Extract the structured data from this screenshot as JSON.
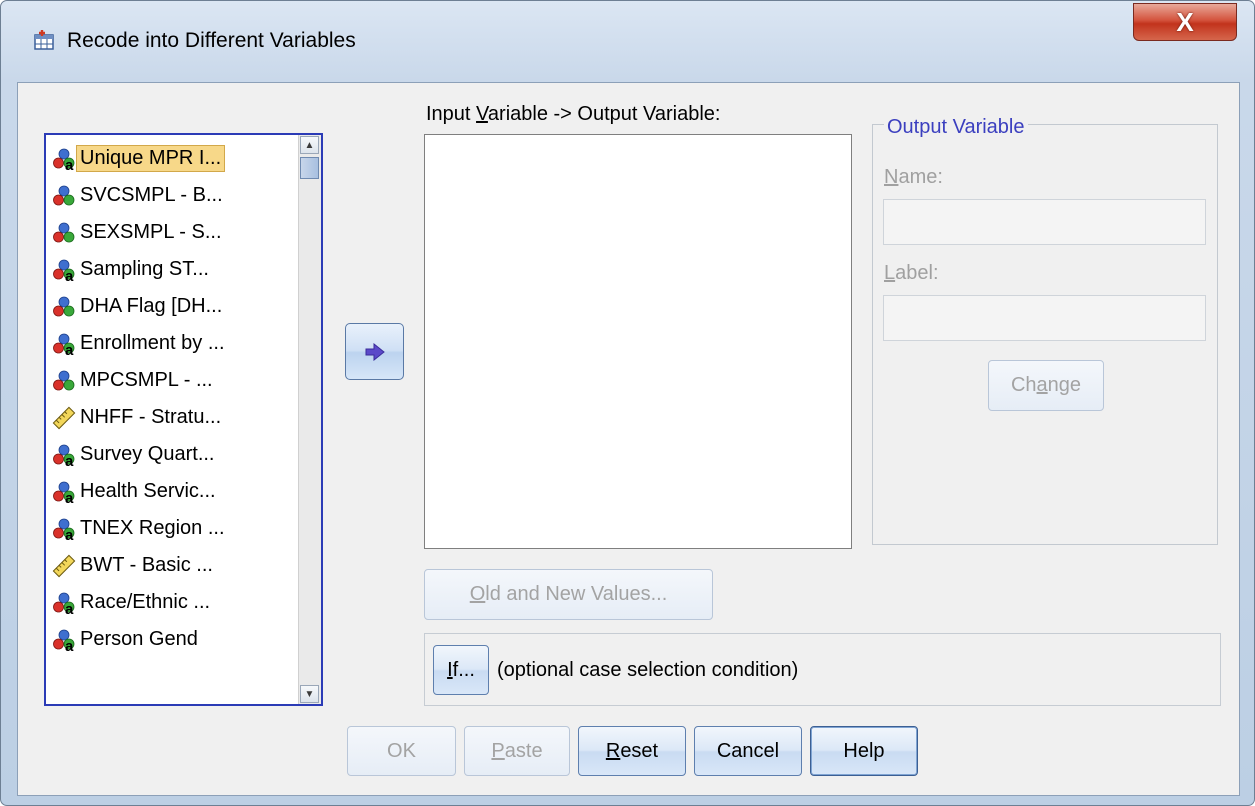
{
  "window": {
    "title": "Recode into Different Variables",
    "close_label": "X"
  },
  "variables": [
    {
      "label": "Unique MPR I...",
      "type": "nominal-string",
      "selected": true
    },
    {
      "label": "SVCSMPL - B...",
      "type": "nominal",
      "selected": false
    },
    {
      "label": "SEXSMPL - S...",
      "type": "nominal",
      "selected": false
    },
    {
      "label": "Sampling ST...",
      "type": "nominal-string",
      "selected": false
    },
    {
      "label": "DHA Flag [DH...",
      "type": "nominal",
      "selected": false
    },
    {
      "label": "Enrollment by ...",
      "type": "nominal-string",
      "selected": false
    },
    {
      "label": "MPCSMPL - ...",
      "type": "nominal",
      "selected": false
    },
    {
      "label": "NHFF - Stratu...",
      "type": "scale",
      "selected": false
    },
    {
      "label": "Survey Quart...",
      "type": "nominal-string",
      "selected": false
    },
    {
      "label": "Health Servic...",
      "type": "nominal-string",
      "selected": false
    },
    {
      "label": "TNEX Region ...",
      "type": "nominal-string",
      "selected": false
    },
    {
      "label": "BWT - Basic ...",
      "type": "scale",
      "selected": false
    },
    {
      "label": "Race/Ethnic ...",
      "type": "nominal-string",
      "selected": false
    },
    {
      "label": "Person Gend",
      "type": "nominal-string",
      "selected": false
    }
  ],
  "io": {
    "label_pre": "Input ",
    "label_u": "V",
    "label_post": "ariable -> Output Variable:"
  },
  "output_variable": {
    "title": "Output Variable",
    "name_label_u": "N",
    "name_label_rest": "ame:",
    "label_label_u": "L",
    "label_label_rest": "abel:",
    "change_pre": "Ch",
    "change_u": "a",
    "change_post": "nge"
  },
  "old_new": {
    "u": "O",
    "rest": "ld and New Values..."
  },
  "if_panel": {
    "button_u": "I",
    "button_rest": "f...",
    "text": "(optional case selection condition)"
  },
  "footer": {
    "ok": "OK",
    "paste_u": "P",
    "paste_rest": "aste",
    "reset_u": "R",
    "reset_rest": "eset",
    "cancel": "Cancel",
    "help": "Help"
  },
  "colors": {
    "list_border": "#2b3bb6",
    "selection": "#f7d889",
    "group_title": "#3b3fbf",
    "disabled_text": "#a0a0a0"
  }
}
